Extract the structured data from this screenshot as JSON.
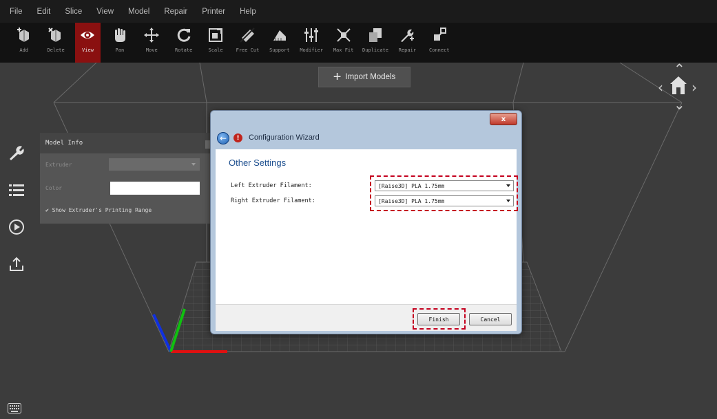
{
  "menu": [
    "File",
    "Edit",
    "Slice",
    "View",
    "Model",
    "Repair",
    "Printer",
    "Help"
  ],
  "toolbar": [
    {
      "label": "Add",
      "icon": "add-model-icon",
      "active": false
    },
    {
      "label": "Delete",
      "icon": "delete-model-icon",
      "active": false
    },
    {
      "label": "View",
      "icon": "eye-icon",
      "active": true
    },
    {
      "label": "Pan",
      "icon": "hand-icon",
      "active": false
    },
    {
      "label": "Move",
      "icon": "move-icon",
      "active": false
    },
    {
      "label": "Rotate",
      "icon": "rotate-icon",
      "active": false
    },
    {
      "label": "Scale",
      "icon": "scale-icon",
      "active": false
    },
    {
      "label": "Free Cut",
      "icon": "cut-icon",
      "active": false
    },
    {
      "label": "Support",
      "icon": "support-icon",
      "active": false
    },
    {
      "label": "Modifier",
      "icon": "modifier-icon",
      "active": false
    },
    {
      "label": "Max Fit",
      "icon": "max-fit-icon",
      "active": false
    },
    {
      "label": "Duplicate",
      "icon": "duplicate-icon",
      "active": false
    },
    {
      "label": "Repair",
      "icon": "repair-icon",
      "active": false
    },
    {
      "label": "Connect",
      "icon": "connect-icon",
      "active": false
    }
  ],
  "import_label": "Import Models",
  "model_info": {
    "title": "Model Info",
    "extruder_label": "Extruder",
    "color_label": "Color",
    "show_range_label": "Show Extruder's Printing Range"
  },
  "dialog": {
    "title": "Configuration Wizard",
    "close_label": "x",
    "heading": "Other Settings",
    "left_label": "Left Extruder Filament:",
    "left_value": "[Raise3D] PLA 1.75mm",
    "right_label": "Right Extruder Filament:",
    "right_value": "[Raise3D] PLA 1.75mm",
    "finish_label": "Finish",
    "cancel_label": "Cancel"
  },
  "colors": {
    "accent_active": "#8a1010",
    "highlight": "#c4001e",
    "heading_blue": "#1d4f8f"
  }
}
